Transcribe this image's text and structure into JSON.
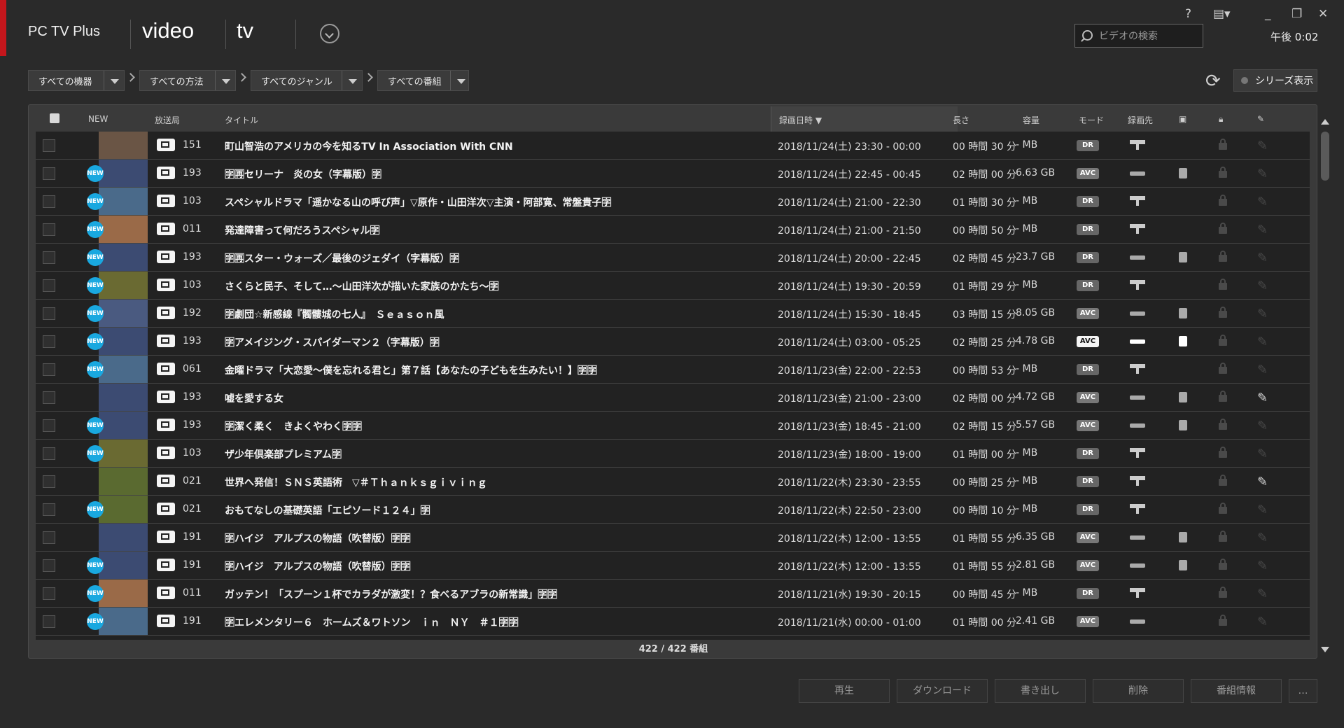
{
  "app": {
    "title": "PC TV Plus"
  },
  "nav": {
    "video": "video",
    "tv": "tv"
  },
  "window": {
    "help": "?",
    "tools_icon": "toolbox-icon",
    "minimize": "_",
    "restore": "❐",
    "close": "✕"
  },
  "search": {
    "placeholder": "ビデオの検索"
  },
  "clock": "午後 0:02",
  "filters": [
    "すべての機器",
    "すべての方法",
    "すべてのジャンル",
    "すべての番組"
  ],
  "series_button": "シリーズ表示",
  "columns": {
    "new": "NEW",
    "channel": "放送局",
    "title": "タイトル",
    "datetime": "録画日時",
    "length": "長さ",
    "size": "容量",
    "mode": "モード",
    "dest": "録画先"
  },
  "rows": [
    {
      "new": false,
      "channel": "151",
      "title": "町山智浩のアメリカの今を知るTV In Association With CNN",
      "datetime": "2018/11/24(土) 23:30 - 00:00",
      "length": "00 時間 30 分",
      "size": "- MB",
      "mode": "DR",
      "dest": "monitor",
      "copy": false,
      "edit": false,
      "thumb": "#6a5545"
    },
    {
      "new": true,
      "channel": "193",
      "title": "🈑🈞セリーナ　炎の女（字幕版）🈑",
      "datetime": "2018/11/24(土) 22:45 - 00:45",
      "length": "02 時間 00 分",
      "size": "6.63 GB",
      "mode": "AVC",
      "dest": "device",
      "copy": true,
      "edit": false,
      "thumb": "#3c4b72"
    },
    {
      "new": true,
      "channel": "103",
      "title": "スペシャルドラマ「遥かなる山の呼び声」▽原作・山田洋次▽主演・阿部寛、常盤貴子🈑",
      "datetime": "2018/11/24(土) 21:00 - 22:30",
      "length": "01 時間 30 分",
      "size": "- MB",
      "mode": "DR",
      "dest": "monitor",
      "copy": false,
      "edit": false,
      "thumb": "#4a6a8a"
    },
    {
      "new": true,
      "channel": "011",
      "title": "発達障害って何だろうスペシャル🈑",
      "datetime": "2018/11/24(土) 21:00 - 21:50",
      "length": "00 時間 50 分",
      "size": "- MB",
      "mode": "DR",
      "dest": "monitor",
      "copy": false,
      "edit": false,
      "thumb": "#9a6a48"
    },
    {
      "new": true,
      "channel": "193",
      "title": "🈑🈞スター・ウォーズ／最後のジェダイ（字幕版）🈑",
      "datetime": "2018/11/24(土) 20:00 - 22:45",
      "length": "02 時間 45 分",
      "size": "23.7 GB",
      "mode": "DR",
      "dest": "device",
      "copy": true,
      "edit": false,
      "thumb": "#3c4b72"
    },
    {
      "new": true,
      "channel": "103",
      "title": "さくらと民子、そして…～山田洋次が描いた家族のかたち～🈑",
      "datetime": "2018/11/24(土) 19:30 - 20:59",
      "length": "01 時間 29 分",
      "size": "- MB",
      "mode": "DR",
      "dest": "monitor",
      "copy": false,
      "edit": false,
      "thumb": "#6a6a32"
    },
    {
      "new": true,
      "channel": "192",
      "title": "🈑劇団☆新感線『髑髏城の七人』　Ｓｅａｓｏｎ風",
      "datetime": "2018/11/24(土) 15:30 - 18:45",
      "length": "03 時間 15 分",
      "size": "8.05 GB",
      "mode": "AVC",
      "dest": "device",
      "copy": true,
      "edit": false,
      "thumb": "#4a5a80"
    },
    {
      "new": true,
      "channel": "193",
      "title": "🈑アメイジング・スパイダーマン２（字幕版）🈑",
      "datetime": "2018/11/24(土) 03:00 - 05:25",
      "length": "02 時間 25 分",
      "size": "4.78 GB",
      "mode": "AVC",
      "dest": "device",
      "copy": true,
      "edit": false,
      "bright": true,
      "thumb": "#3c4b72"
    },
    {
      "new": true,
      "channel": "061",
      "title": "金曜ドラマ「大恋愛～僕を忘れる君と」第７話【あなたの子どもを生みたい！】🈑🈑",
      "datetime": "2018/11/23(金) 22:00 - 22:53",
      "length": "00 時間 53 分",
      "size": "- MB",
      "mode": "DR",
      "dest": "monitor",
      "copy": false,
      "edit": false,
      "thumb": "#4a6a8a"
    },
    {
      "new": false,
      "channel": "193",
      "title": "嘘を愛する女",
      "datetime": "2018/11/23(金) 21:00 - 23:00",
      "length": "02 時間 00 分",
      "size": "4.72 GB",
      "mode": "AVC",
      "dest": "device",
      "copy": true,
      "edit": true,
      "thumb": "#3c4b72"
    },
    {
      "new": true,
      "channel": "193",
      "title": "🈑潔く柔く　きよくやわく🈑🈑",
      "datetime": "2018/11/23(金) 18:45 - 21:00",
      "length": "02 時間 15 分",
      "size": "5.57 GB",
      "mode": "AVC",
      "dest": "device",
      "copy": true,
      "edit": false,
      "thumb": "#3c4b72"
    },
    {
      "new": true,
      "channel": "103",
      "title": "ザ少年倶楽部プレミアム🈑",
      "datetime": "2018/11/23(金) 18:00 - 19:00",
      "length": "01 時間 00 分",
      "size": "- MB",
      "mode": "DR",
      "dest": "monitor",
      "copy": false,
      "edit": false,
      "thumb": "#6a6a32"
    },
    {
      "new": false,
      "channel": "021",
      "title": "世界へ発信！ＳＮＳ英語術　▽＃Ｔｈａｎｋｓｇｉｖｉｎｇ",
      "datetime": "2018/11/22(木) 23:30 - 23:55",
      "length": "00 時間 25 分",
      "size": "- MB",
      "mode": "DR",
      "dest": "monitor",
      "copy": false,
      "edit": true,
      "thumb": "#5a6a30"
    },
    {
      "new": true,
      "channel": "021",
      "title": "おもてなしの基礎英語「エピソード１２４」🈑",
      "datetime": "2018/11/22(木) 22:50 - 23:00",
      "length": "00 時間 10 分",
      "size": "- MB",
      "mode": "DR",
      "dest": "monitor",
      "copy": false,
      "edit": false,
      "thumb": "#5a6a30"
    },
    {
      "new": false,
      "channel": "191",
      "title": "🈑ハイジ　アルプスの物語（吹替版）🈑🈑",
      "datetime": "2018/11/22(木) 12:00 - 13:55",
      "length": "01 時間 55 分",
      "size": "6.35 GB",
      "mode": "AVC",
      "dest": "device",
      "copy": true,
      "edit": false,
      "thumb": "#3c4b72"
    },
    {
      "new": true,
      "channel": "191",
      "title": "🈑ハイジ　アルプスの物語（吹替版）🈑🈑",
      "datetime": "2018/11/22(木) 12:00 - 13:55",
      "length": "01 時間 55 分",
      "size": "2.81 GB",
      "mode": "AVC",
      "dest": "device",
      "copy": true,
      "edit": false,
      "thumb": "#3c4b72"
    },
    {
      "new": true,
      "channel": "011",
      "title": "ガッテン！「スプーン１杯でカラダが激変！？食べるアブラの新常識」🈑🈑",
      "datetime": "2018/11/21(水) 19:30 - 20:15",
      "length": "00 時間 45 分",
      "size": "- MB",
      "mode": "DR",
      "dest": "monitor",
      "copy": false,
      "edit": false,
      "thumb": "#9a6a48"
    },
    {
      "new": true,
      "channel": "191",
      "title": "🈑エレメンタリー６　ホームズ＆ワトソン　ｉｎ　ＮＹ　＃１🈑🈑",
      "datetime": "2018/11/21(水) 00:00 - 01:00",
      "length": "01 時間 00 分",
      "size": "2.41 GB",
      "mode": "AVC",
      "dest": "device",
      "copy": false,
      "edit": false,
      "thumb": "#4a6a8a"
    }
  ],
  "count": "422 / 422 番組",
  "actions": [
    "再生",
    "ダウンロード",
    "書き出し",
    "削除",
    "番組情報",
    "…"
  ]
}
